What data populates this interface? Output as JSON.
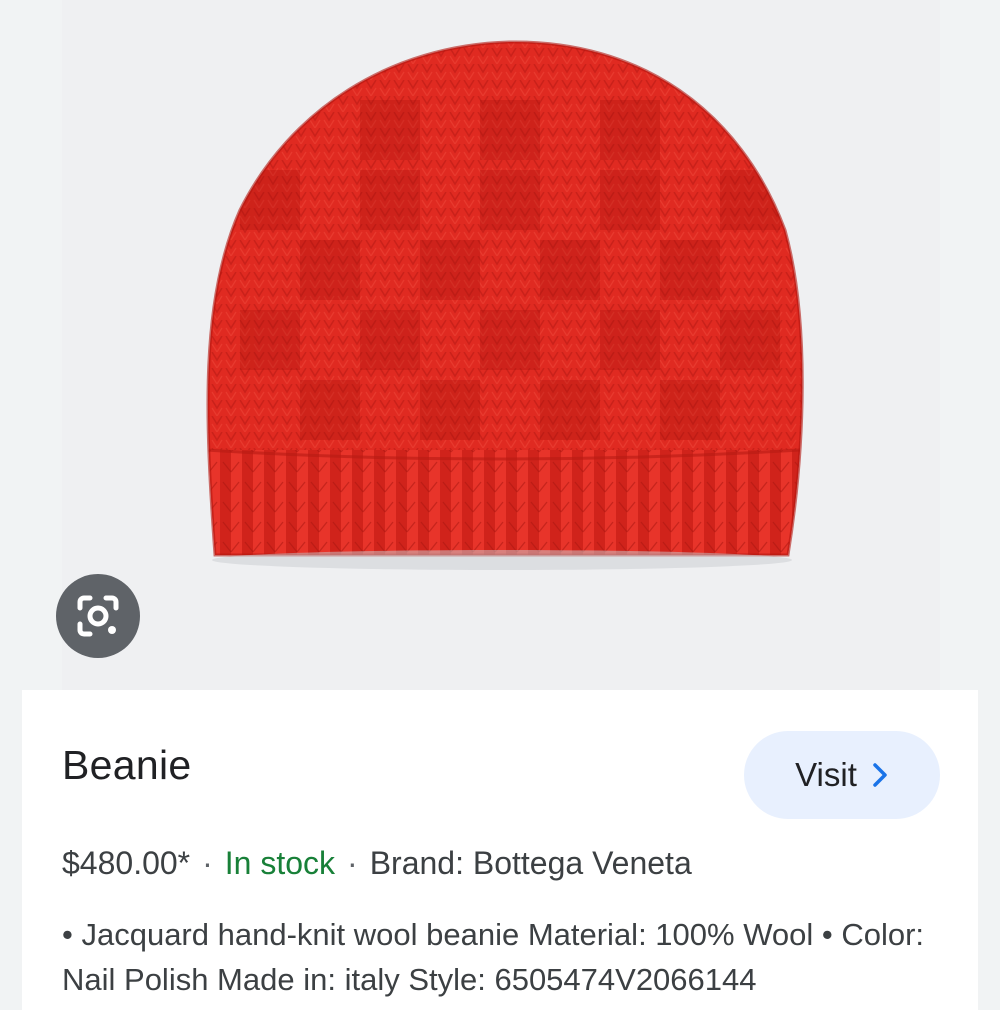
{
  "product": {
    "title": "Beanie",
    "price": "$480.00*",
    "separator": "·",
    "stock_status": "In stock",
    "brand": "Brand: Bottega Veneta",
    "description": "• Jacquard hand-knit wool beanie Material: 100% Wool • Color: Nail Polish Made in: italy Style: 6505474V2066144"
  },
  "visit_button": {
    "label": "Visit",
    "icon": "chevron-right-icon"
  },
  "lens_button": {
    "icon": "google-lens-icon"
  },
  "colors": {
    "beanie": "#e02a21",
    "stock_green": "#188038",
    "visit_bg": "#e8f0fe",
    "accent_blue": "#1a73e8",
    "lens_bg": "#5f6368"
  }
}
